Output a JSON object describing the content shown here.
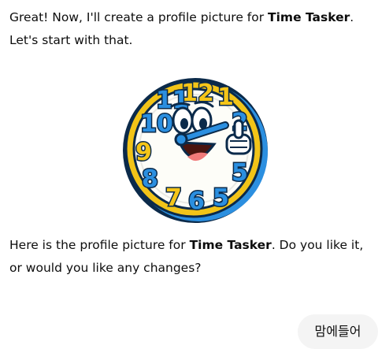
{
  "messages": {
    "intro": {
      "before": "Great! Now, I'll create a profile picture for ",
      "bold": "Time Tasker",
      "after": ". Let's start with that."
    },
    "followup": {
      "before": "Here is the profile picture for ",
      "bold": "Time Tasker",
      "after": ". Do you like it, or would you like any changes?"
    }
  },
  "image": {
    "digits": {
      "n12": "12",
      "n1": "1",
      "n11": "11",
      "n10": "10",
      "n2": "2",
      "n9": "9",
      "n8": "8",
      "n7": "7",
      "n6": "6",
      "n5a": "5",
      "n5b": "5"
    },
    "colors": {
      "rim": "#f2c418",
      "face": "#fdfdf8",
      "blue_digit": "#2b8fe0",
      "yellow_digit": "#f5c518",
      "hand": "#2b8fe0"
    }
  },
  "user_message": {
    "text": "맘에들어"
  }
}
